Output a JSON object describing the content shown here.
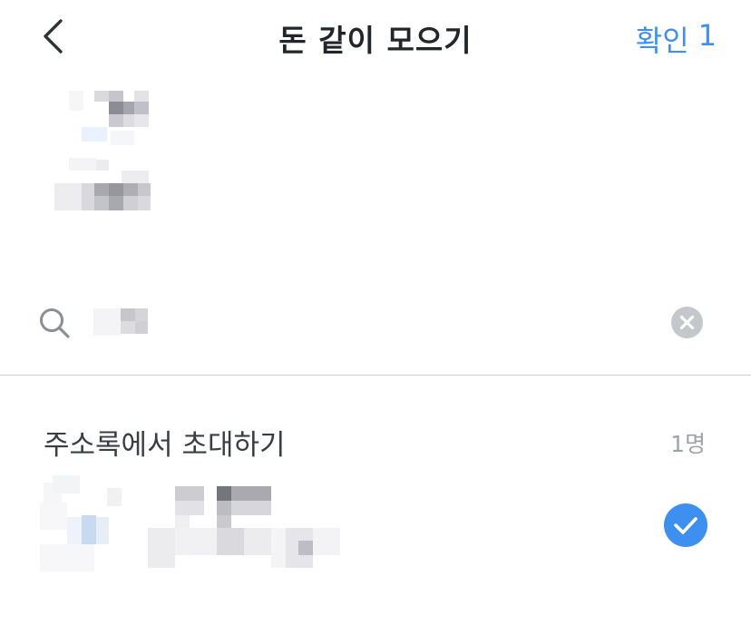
{
  "header": {
    "title": "돈 같이 모으기",
    "confirm_label": "확인",
    "confirm_count": "1",
    "back_icon": "chevron-left-icon"
  },
  "search": {
    "icon": "search-icon",
    "clear_icon": "clear-icon"
  },
  "section": {
    "title": "주소록에서 초대하기",
    "count": "1명"
  },
  "contacts": [
    {
      "selected": true,
      "check_icon": "checkmark-icon"
    }
  ],
  "colors": {
    "accent": "#3d8ff0",
    "title": "#22262b",
    "section_text": "#3a3e44",
    "muted": "#9ea3a8",
    "divider": "#d6d8db",
    "clear_button": "#c4c7cb"
  }
}
